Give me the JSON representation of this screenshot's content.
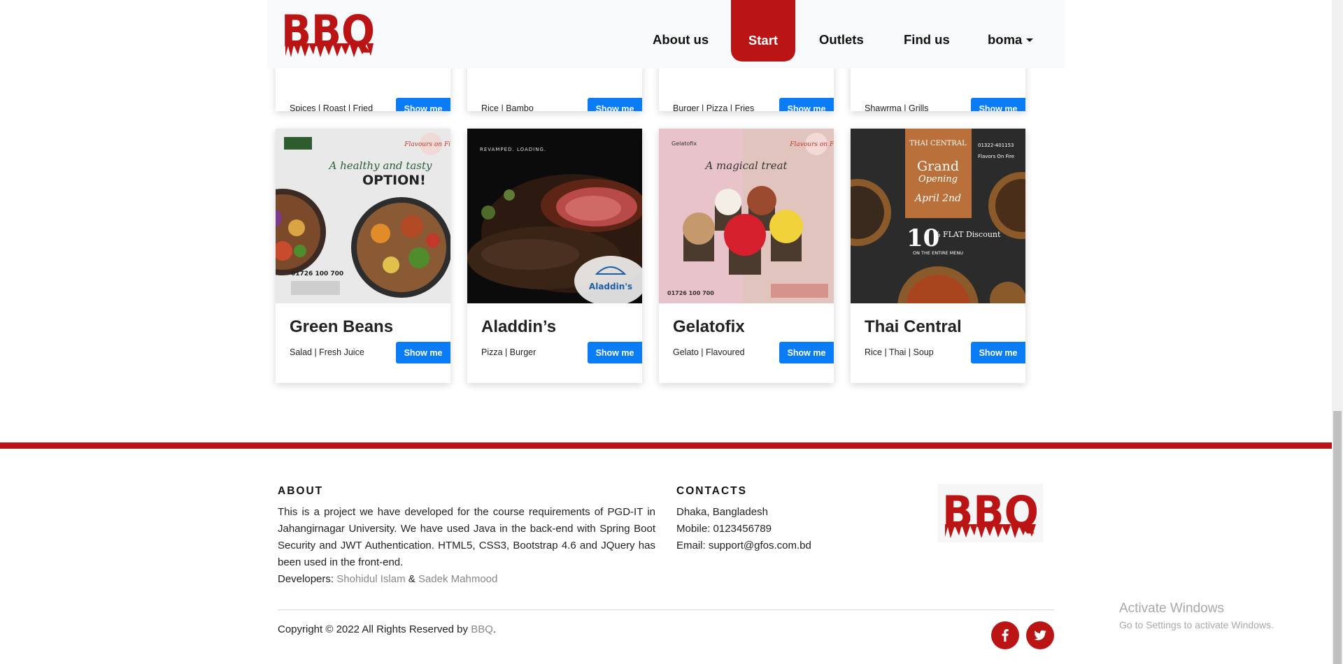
{
  "brand": {
    "name": "BBQ",
    "logo_text": "BBQ",
    "color": "#bb1414"
  },
  "nav": {
    "about_label": "About us",
    "start_label": "Start",
    "outlets_label": "Outlets",
    "findus_label": "Find us",
    "user_label": "boma"
  },
  "cards_top": [
    {
      "tags": "Spices | Roast | Fried",
      "button": "Show me"
    },
    {
      "tags": "Rice | Bambo",
      "button": "Show me"
    },
    {
      "tags": "Burger | Pizza | Fries",
      "button": "Show me"
    },
    {
      "tags": "Shawrma | Grills",
      "button": "Show me"
    }
  ],
  "cards": [
    {
      "name": "Green Beans",
      "tags": "Salad | Fresh Juice",
      "button": "Show me",
      "poster": {
        "headline": "A healthy and tasty",
        "sub": "OPTION!",
        "phone": "01726 100 700",
        "badge": "Flavours on Fire"
      }
    },
    {
      "name": "Aladdin’s",
      "tags": "Pizza | Burger",
      "button": "Show me",
      "poster": {
        "headline": "REVAMPED. LOADING.",
        "logo": "Aladdin's"
      }
    },
    {
      "name": "Gelatofix",
      "tags": "Gelato | Flavoured",
      "button": "Show me",
      "poster": {
        "brand": "Gelatofix",
        "headline": "A magical treat",
        "phone": "01726 100 700",
        "badge": "Flavours on Fire"
      }
    },
    {
      "name": "Thai Central",
      "tags": "Rice | Thai | Soup",
      "button": "Show me",
      "poster": {
        "brand": "THAI CENTRAL",
        "title1": "Grand",
        "title2": "Opening",
        "date": "April 2nd",
        "discount": "10",
        "discount_label": "% FLAT Discount",
        "discount_sub": "ON THE ENTIRE MENU",
        "phone": "01322-401153",
        "place": "Flavors On Fire"
      }
    }
  ],
  "footer": {
    "about_heading": "ABOUT",
    "about_text": "This is a project we have developed for the course requirements of PGD-IT in Jahangirnagar University. We have used Java in the back-end with Spring Boot Security and JWT Authentication. HTML5, CSS3, Bootstrap 4.6 and JQuery has been used in the front-end.",
    "developers_label": "Developers:",
    "developer_1": "Shohidul Islam",
    "developer_sep": " & ",
    "developer_2": "Sadek Mahmood",
    "contacts_heading": "CONTACTS",
    "address": "Dhaka, Bangladesh",
    "mobile": "Mobile: 0123456789",
    "email": "Email: support@gfos.com.bd",
    "copyright_prefix": "Copyright © 2022 All Rights Reserved by ",
    "copyright_brand": "BBQ",
    "copyright_suffix": ".",
    "social_icons": [
      "facebook-icon",
      "twitter-icon"
    ]
  },
  "watermark": {
    "line1": "Activate Windows",
    "line2": "Go to Settings to activate Windows."
  }
}
